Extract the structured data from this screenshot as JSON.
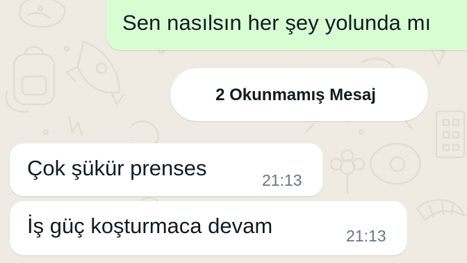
{
  "outgoing_message": {
    "text": "Sen nasılsın her şey yolunda mı"
  },
  "unread_banner": {
    "label": "2 Okunmamış Mesaj"
  },
  "incoming_messages": [
    {
      "text": "Çok şükür prenses",
      "time": "21:13"
    },
    {
      "text": "İş güç koşturmaca devam",
      "time": "21:13"
    }
  ],
  "colors": {
    "chat_background": "#efeae2",
    "outgoing_bubble": "#d9fdd3",
    "incoming_bubble": "#ffffff",
    "timestamp": "#667781",
    "text": "#111b21"
  },
  "icons": [
    "taco-icon",
    "backpack-icon",
    "rocket-icon",
    "fried-egg-icon",
    "croissant-icon",
    "building-icon",
    "flower-icon"
  ]
}
